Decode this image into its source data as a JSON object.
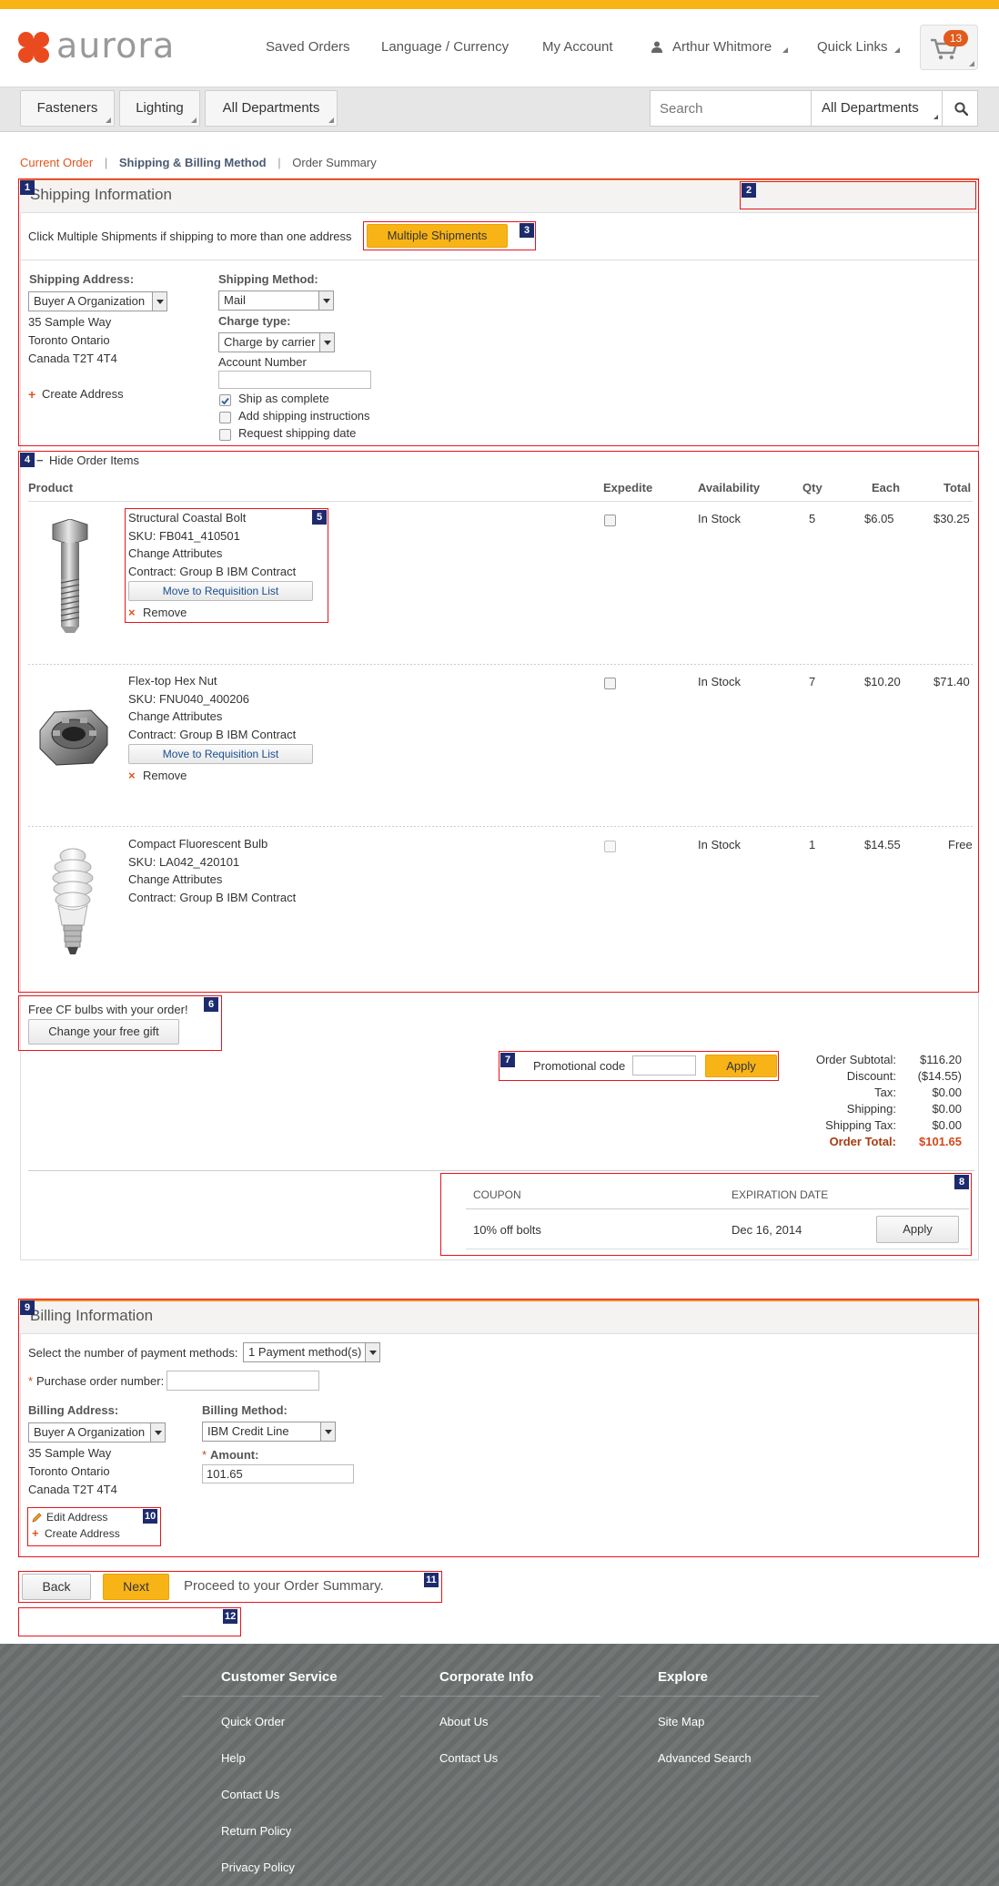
{
  "header": {
    "logo_text": "aurora",
    "nav": [
      "Saved Orders",
      "Language / Currency",
      "My Account"
    ],
    "user_name": "Arthur Whitmore",
    "quick_links": "Quick Links",
    "cart_count": "13"
  },
  "navbar": {
    "departments": [
      "Fasteners",
      "Lighting",
      "All Departments"
    ],
    "search_placeholder": "Search",
    "search_scope": "All Departments"
  },
  "breadcrumb": [
    "Current Order",
    "Shipping & Billing Method",
    "Order Summary"
  ],
  "badges": [
    "1",
    "2",
    "3",
    "4",
    "5",
    "6",
    "7",
    "8",
    "9",
    "10",
    "11",
    "12"
  ],
  "shipping": {
    "title": "Shipping Information",
    "multi_text": "Click Multiple Shipments if shipping to more than one address",
    "multi_button": "Multiple Shipments",
    "address_label": "Shipping Address:",
    "address_select": "Buyer A Organization",
    "address_lines": [
      "35 Sample Way",
      "Toronto Ontario",
      "Canada T2T 4T4"
    ],
    "create_address": "Create Address",
    "method_label": "Shipping Method:",
    "method_value": "Mail",
    "charge_label": "Charge type:",
    "charge_value": "Charge by carrier",
    "account_label": "Account Number",
    "options": [
      {
        "label": "Ship as complete",
        "checked": true
      },
      {
        "label": "Add shipping instructions",
        "checked": false
      },
      {
        "label": "Request shipping date",
        "checked": false
      }
    ]
  },
  "order_items": {
    "toggle": "Hide Order Items",
    "columns": [
      "Product",
      "Expedite",
      "Availability",
      "Qty",
      "Each",
      "Total"
    ],
    "items": [
      {
        "name": "Structural Coastal Bolt",
        "sku": "SKU: FB041_410501",
        "change": "Change Attributes",
        "contract": "Contract: Group B IBM Contract",
        "move": "Move to Requisition List",
        "remove": "Remove",
        "availability": "In Stock",
        "qty": "5",
        "each": "$6.05",
        "total": "$30.25"
      },
      {
        "name": "Flex-top Hex Nut",
        "sku": "SKU: FNU040_400206",
        "change": "Change Attributes",
        "contract": "Contract: Group B IBM Contract",
        "move": "Move to Requisition List",
        "remove": "Remove",
        "availability": "In Stock",
        "qty": "7",
        "each": "$10.20",
        "total": "$71.40"
      },
      {
        "name": "Compact Fluorescent Bulb",
        "sku": "SKU: LA042_420101",
        "change": "Change Attributes",
        "contract": "Contract: Group B IBM Contract",
        "availability": "In Stock",
        "qty": "1",
        "each": "$14.55",
        "total": "Free"
      }
    ]
  },
  "gift": {
    "text": "Free CF bulbs with your order!",
    "button": "Change your free gift"
  },
  "promo": {
    "label": "Promotional code",
    "button": "Apply"
  },
  "totals": [
    {
      "label": "Order Subtotal:",
      "value": "$116.20"
    },
    {
      "label": "Discount:",
      "value": "($14.55)"
    },
    {
      "label": "Tax:",
      "value": "$0.00"
    },
    {
      "label": "Shipping:",
      "value": "$0.00"
    },
    {
      "label": "Shipping Tax:",
      "value": "$0.00"
    },
    {
      "label": "Order Total:",
      "value": "$101.65"
    }
  ],
  "coupons": {
    "headers": [
      "COUPON",
      "EXPIRATION DATE"
    ],
    "rows": [
      {
        "name": "10% off bolts",
        "date": "Dec 16, 2014",
        "button": "Apply"
      }
    ]
  },
  "billing": {
    "title": "Billing Information",
    "payment_label": "Select the number of payment methods:",
    "payment_value": "1 Payment method(s)",
    "po_label": "Purchase order number:",
    "address_label": "Billing Address:",
    "address_select": "Buyer A Organization",
    "address_lines": [
      "35 Sample Way",
      "Toronto Ontario",
      "Canada T2T 4T4"
    ],
    "method_label": "Billing Method:",
    "method_value": "IBM Credit Line",
    "amount_label": "Amount:",
    "amount_value": "101.65",
    "edit_address": "Edit Address",
    "create_address": "Create Address"
  },
  "actions": {
    "back": "Back",
    "next": "Next",
    "hint": "Proceed to your Order Summary."
  },
  "footer": {
    "columns": [
      {
        "title": "Customer Service",
        "links": [
          "Quick Order",
          "Help",
          "Contact Us",
          "Return Policy",
          "Privacy Policy"
        ]
      },
      {
        "title": "Corporate Info",
        "links": [
          "About Us",
          "Contact Us"
        ]
      },
      {
        "title": "Explore",
        "links": [
          "Site Map",
          "Advanced Search"
        ]
      }
    ]
  }
}
